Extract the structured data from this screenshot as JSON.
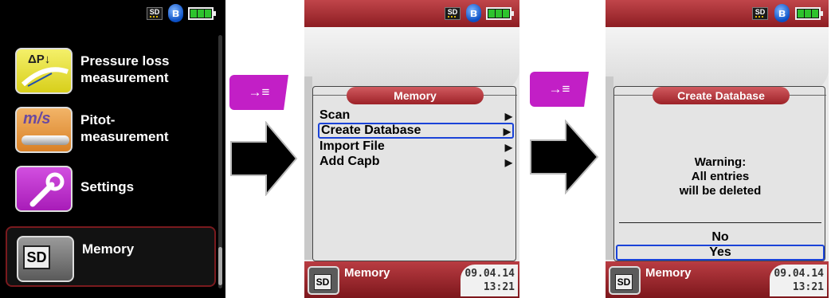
{
  "status": {
    "sd_label": "SD",
    "bluetooth_glyph": "ʙ"
  },
  "main_menu": {
    "items": [
      {
        "label": "Pressure loss\nmeasurement",
        "icon": "pressure-gauge-icon",
        "tile_text": "ΔP↓"
      },
      {
        "label": "Pitot-\nmeasurement",
        "icon": "pitot-tube-icon",
        "tile_text": "m/s"
      },
      {
        "label": "Settings",
        "icon": "wrench-icon"
      },
      {
        "label": "Memory",
        "icon": "sd-card-icon",
        "tile_text": "SD"
      }
    ],
    "selected": "Memory"
  },
  "key_glyph": "→≡",
  "memory_screen": {
    "title": "Memory",
    "items": [
      "Scan",
      "Create Database",
      "Import File",
      "Add Capb"
    ],
    "arrow_glyph": "▶",
    "highlighted": "Create Database"
  },
  "create_db_screen": {
    "title": "Create Database",
    "warning_lines": [
      "Warning:",
      "All entries",
      "will be deleted"
    ],
    "options": [
      "No",
      "Yes"
    ],
    "highlighted": "Yes"
  },
  "footer": {
    "label": "Memory",
    "date": "09.04.14",
    "time": "13:21",
    "icon_text": "SD"
  },
  "colors": {
    "accent_red": "#9d2228",
    "key_magenta": "#c21fc6",
    "selection_blue": "#1a43d8",
    "battery_green": "#2dc32d"
  }
}
